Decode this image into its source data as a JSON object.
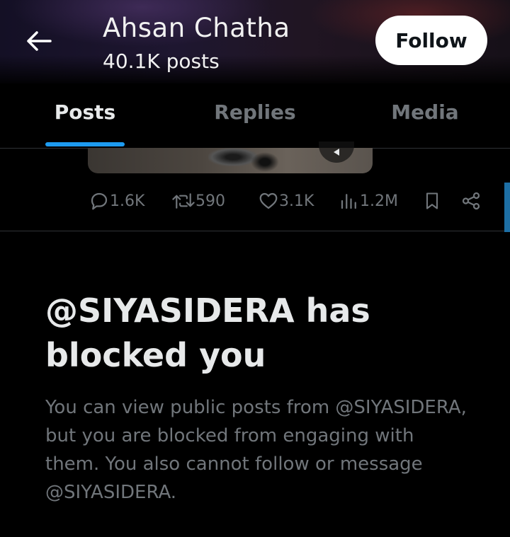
{
  "header": {
    "title": "Ahsan Chatha",
    "subtitle": "40.1K posts",
    "follow_label": "Follow",
    "back_icon": "arrow-left-icon"
  },
  "tabs": [
    {
      "label": "Posts",
      "active": true
    },
    {
      "label": "Replies",
      "active": false
    },
    {
      "label": "Media",
      "active": false
    }
  ],
  "post_actions": {
    "replies": "1.6K",
    "reposts": "590",
    "likes": "3.1K",
    "views": "1.2M",
    "bookmark_icon": "bookmark-icon",
    "share_icon": "share-icon"
  },
  "blocked": {
    "title": "@SIYASIDERA has blocked you",
    "description": "You can view public posts from @SIYASIDERA, but you are blocked from engaging with them. You also cannot follow or message @SIYASIDERA."
  },
  "colors": {
    "accent": "#1d9bf0",
    "background": "#000000",
    "muted_text": "#71767b",
    "primary_text": "#e7e9ea"
  }
}
